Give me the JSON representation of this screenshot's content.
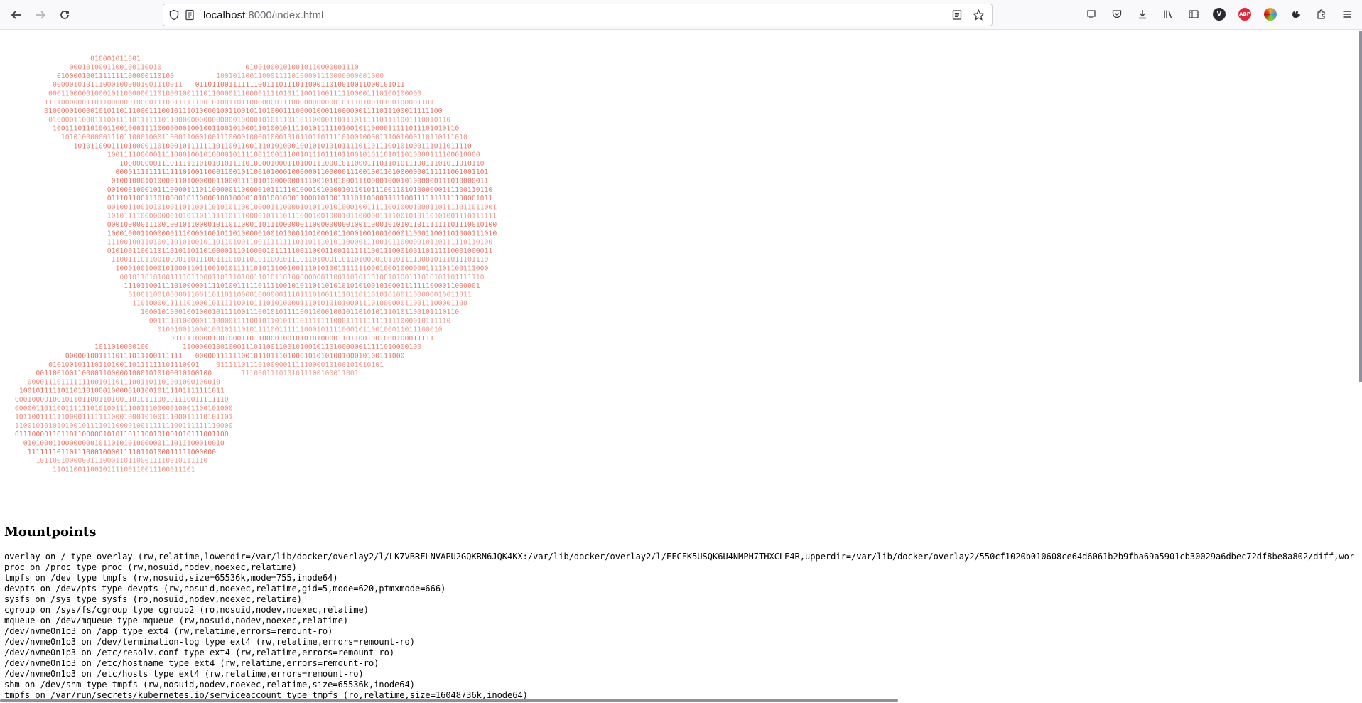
{
  "browser": {
    "url_host": "localhost",
    "url_path": ":8000/index.html",
    "icons": [
      "back-arrow-icon",
      "forward-arrow-icon",
      "reload-icon",
      "shield-icon",
      "page-info-icon",
      "reader-view-icon",
      "bookmark-star-icon",
      "firefox-view-icon",
      "pocket-icon",
      "downloads-icon",
      "library-icon",
      "sidebar-icon",
      "extension-v-icon",
      "adblock-icon",
      "extension-color-icon",
      "extension-puzzle-hand-icon",
      "extensions-icon",
      "menu-icon"
    ],
    "ext_v_label": "V",
    "adblock_label": "ABP"
  },
  "art": {
    "color": "#e05a4a",
    "description_colors": [
      "#e8735f",
      "#f3b3a8"
    ]
  },
  "mounts": {
    "heading": "Mountpoints",
    "lines": [
      "overlay on / type overlay (rw,relatime,lowerdir=/var/lib/docker/overlay2/l/LK7VBRFLNVAPU2GQKRN6JQK4KX:/var/lib/docker/overlay2/l/EFCFK5USQK6U4NMPH7THXCLE4R,upperdir=/var/lib/docker/overlay2/550cf1020b010608ce64d6061b2b9fba69a5901cb30029a6dbec72df8be8a802/diff,workd",
      "proc on /proc type proc (rw,nosuid,nodev,noexec,relatime)",
      "tmpfs on /dev type tmpfs (rw,nosuid,size=65536k,mode=755,inode64)",
      "devpts on /dev/pts type devpts (rw,nosuid,noexec,relatime,gid=5,mode=620,ptmxmode=666)",
      "sysfs on /sys type sysfs (ro,nosuid,nodev,noexec,relatime)",
      "cgroup on /sys/fs/cgroup type cgroup2 (ro,nosuid,nodev,noexec,relatime)",
      "mqueue on /dev/mqueue type mqueue (rw,nosuid,nodev,noexec,relatime)",
      "/dev/nvme0n1p3 on /app type ext4 (rw,relatime,errors=remount-ro)",
      "/dev/nvme0n1p3 on /dev/termination-log type ext4 (rw,relatime,errors=remount-ro)",
      "/dev/nvme0n1p3 on /etc/resolv.conf type ext4 (rw,relatime,errors=remount-ro)",
      "/dev/nvme0n1p3 on /etc/hostname type ext4 (rw,relatime,errors=remount-ro)",
      "/dev/nvme0n1p3 on /etc/hosts type ext4 (rw,relatime,errors=remount-ro)",
      "shm on /dev/shm type tmpfs (rw,nosuid,nodev,noexec,relatime,size=65536k,inode64)",
      "tmpfs on /var/run/secrets/kubernetes.io/serviceaccount type tmpfs (ro,relatime,size=16048736k,inode64)"
    ]
  }
}
